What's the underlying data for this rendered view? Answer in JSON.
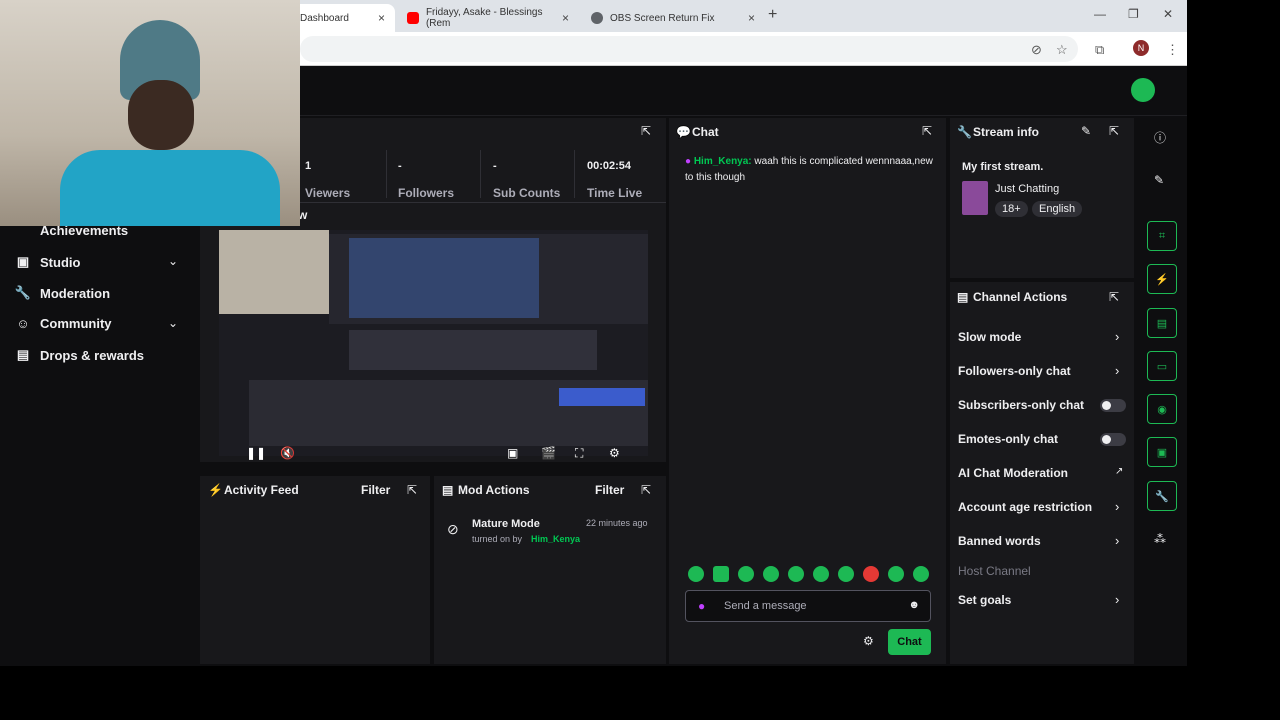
{
  "browser": {
    "tabs": [
      {
        "title": "Dashboard",
        "fav_color": "#9146ff"
      },
      {
        "title": "Fridayy, Asake - Blessings (Rem",
        "fav_color": "#ff0000"
      },
      {
        "title": "OBS Screen Return Fix",
        "fav_color": "#5f6368"
      }
    ],
    "close_glyph": "×",
    "newtab_glyph": "+",
    "profile_initial": "N"
  },
  "stats": [
    {
      "value": "1",
      "label": "Viewers"
    },
    {
      "value": "-",
      "label": "Followers"
    },
    {
      "value": "-",
      "label": "Sub Counts"
    },
    {
      "value": "00:02:54",
      "label": "Time Live"
    }
  ],
  "stream_preview": {
    "partial_title": "w"
  },
  "sidebar": {
    "items": [
      {
        "label": "Achievements",
        "icon": "trophy-icon",
        "has_chevron": false
      },
      {
        "label": "Studio",
        "icon": "studio-icon",
        "has_chevron": true
      },
      {
        "label": "Moderation",
        "icon": "wrench-icon",
        "has_chevron": false
      },
      {
        "label": "Community",
        "icon": "community-icon",
        "has_chevron": true
      },
      {
        "label": "Drops & rewards",
        "icon": "drops-icon",
        "has_chevron": false
      }
    ]
  },
  "activity_feed": {
    "title": "Activity Feed",
    "filter_label": "Filter"
  },
  "mod_actions": {
    "title": "Mod Actions",
    "filter_label": "Filter",
    "entry": {
      "action": "Mature Mode",
      "time": "22 minutes ago",
      "detail": "turned on by",
      "user": "Him_Kenya"
    }
  },
  "chat": {
    "title": "Chat",
    "message": {
      "user": "Him_Kenya",
      "text": "waah this is complicated wennnaaa,new to this though"
    },
    "placeholder": "Send a message",
    "send_label": "Chat"
  },
  "stream_info": {
    "title": "Stream info",
    "stream_title": "My first stream.",
    "category": "Just Chatting",
    "tags": [
      "18+",
      "English"
    ]
  },
  "channel_actions": {
    "title": "Channel Actions",
    "items": [
      {
        "label": "Slow mode",
        "control": "chevron"
      },
      {
        "label": "Followers-only chat",
        "control": "chevron"
      },
      {
        "label": "Subscribers-only chat",
        "control": "toggle"
      },
      {
        "label": "Emotes-only chat",
        "control": "toggle"
      },
      {
        "label": "AI Chat Moderation",
        "control": "external"
      },
      {
        "label": "Account age restriction",
        "control": "chevron"
      },
      {
        "label": "Banned words",
        "control": "chevron"
      },
      {
        "label": "Host Channel",
        "control": "none"
      },
      {
        "label": "Set goals",
        "control": "chevron"
      }
    ]
  },
  "colors": {
    "accent": "#1db954",
    "background": "#0e0e10",
    "panel": "#18181b"
  }
}
